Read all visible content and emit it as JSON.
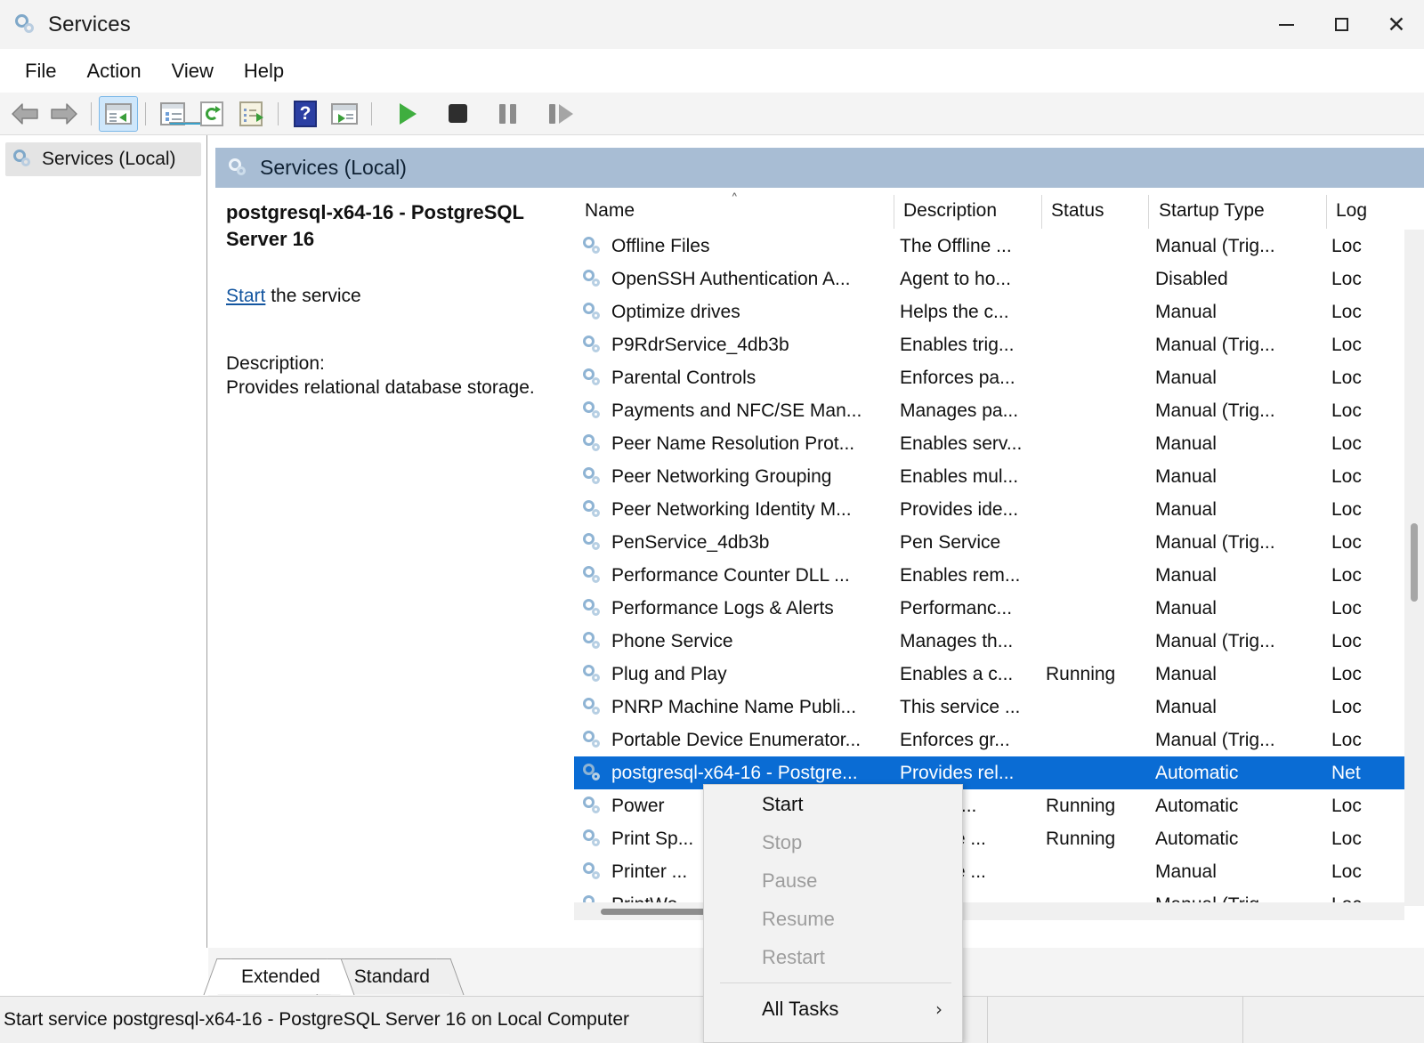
{
  "window": {
    "title": "Services",
    "icon": "services-gear-icon",
    "controls": {
      "minimize": "–",
      "maximize": "□",
      "close": "✕"
    }
  },
  "menubar": {
    "items": [
      "File",
      "Action",
      "View",
      "Help"
    ]
  },
  "toolbar": {
    "buttons": [
      {
        "name": "back-icon",
        "label": "Back"
      },
      {
        "name": "forward-icon",
        "label": "Forward"
      },
      {
        "name": "show-hide-console-tree-icon",
        "label": "Show/Hide Console Tree"
      },
      {
        "name": "properties-icon",
        "label": "Properties"
      },
      {
        "name": "refresh-icon",
        "label": "Refresh"
      },
      {
        "name": "export-list-icon",
        "label": "Export List"
      },
      {
        "name": "help-icon",
        "label": "Help"
      },
      {
        "name": "show-action-pane-icon",
        "label": "Show Action Pane"
      },
      {
        "name": "start-service-icon",
        "label": "Start Service"
      },
      {
        "name": "stop-service-icon",
        "label": "Stop Service"
      },
      {
        "name": "pause-service-icon",
        "label": "Pause Service"
      },
      {
        "name": "restart-service-icon",
        "label": "Restart Service"
      }
    ]
  },
  "sidebar": {
    "items": [
      {
        "label": "Services (Local)",
        "icon": "services-gear-icon"
      }
    ]
  },
  "detail": {
    "header_title": "Services (Local)",
    "service_title": "postgresql-x64-16 - PostgreSQL Server 16",
    "action_link": "Start",
    "action_suffix": " the service",
    "description_label": "Description:",
    "description_text": "Provides relational database storage."
  },
  "list": {
    "columns": [
      {
        "key": "name",
        "label": "Name",
        "sorted": "asc",
        "sort_caret": "˄"
      },
      {
        "key": "description",
        "label": "Description"
      },
      {
        "key": "status",
        "label": "Status"
      },
      {
        "key": "startup",
        "label": "Startup Type"
      },
      {
        "key": "logon",
        "label": "Log"
      }
    ],
    "rows": [
      {
        "name": "Offline Files",
        "description": "The Offline ...",
        "status": "",
        "startup": "Manual (Trig...",
        "logon": "Loc",
        "selected": false
      },
      {
        "name": "OpenSSH Authentication A...",
        "description": "Agent to ho...",
        "status": "",
        "startup": "Disabled",
        "logon": "Loc",
        "selected": false
      },
      {
        "name": "Optimize drives",
        "description": "Helps the c...",
        "status": "",
        "startup": "Manual",
        "logon": "Loc",
        "selected": false
      },
      {
        "name": "P9RdrService_4db3b",
        "description": "Enables trig...",
        "status": "",
        "startup": "Manual (Trig...",
        "logon": "Loc",
        "selected": false
      },
      {
        "name": "Parental Controls",
        "description": "Enforces pa...",
        "status": "",
        "startup": "Manual",
        "logon": "Loc",
        "selected": false
      },
      {
        "name": "Payments and NFC/SE Man...",
        "description": "Manages pa...",
        "status": "",
        "startup": "Manual (Trig...",
        "logon": "Loc",
        "selected": false
      },
      {
        "name": "Peer Name Resolution Prot...",
        "description": "Enables serv...",
        "status": "",
        "startup": "Manual",
        "logon": "Loc",
        "selected": false
      },
      {
        "name": "Peer Networking Grouping",
        "description": "Enables mul...",
        "status": "",
        "startup": "Manual",
        "logon": "Loc",
        "selected": false
      },
      {
        "name": "Peer Networking Identity M...",
        "description": "Provides ide...",
        "status": "",
        "startup": "Manual",
        "logon": "Loc",
        "selected": false
      },
      {
        "name": "PenService_4db3b",
        "description": "Pen Service",
        "status": "",
        "startup": "Manual (Trig...",
        "logon": "Loc",
        "selected": false
      },
      {
        "name": "Performance Counter DLL ...",
        "description": "Enables rem...",
        "status": "",
        "startup": "Manual",
        "logon": "Loc",
        "selected": false
      },
      {
        "name": "Performance Logs & Alerts",
        "description": "Performanc...",
        "status": "",
        "startup": "Manual",
        "logon": "Loc",
        "selected": false
      },
      {
        "name": "Phone Service",
        "description": "Manages th...",
        "status": "",
        "startup": "Manual (Trig...",
        "logon": "Loc",
        "selected": false
      },
      {
        "name": "Plug and Play",
        "description": "Enables a c...",
        "status": "Running",
        "startup": "Manual",
        "logon": "Loc",
        "selected": false
      },
      {
        "name": "PNRP Machine Name Publi...",
        "description": "This service ...",
        "status": "",
        "startup": "Manual",
        "logon": "Loc",
        "selected": false
      },
      {
        "name": "Portable Device Enumerator...",
        "description": "Enforces gr...",
        "status": "",
        "startup": "Manual (Trig...",
        "logon": "Loc",
        "selected": false
      },
      {
        "name": "postgresql-x64-16 - Postgre...",
        "description": "Provides rel...",
        "status": "",
        "startup": "Automatic",
        "logon": "Net",
        "selected": true
      },
      {
        "name": "Power",
        "description": "...ges p...",
        "status": "Running",
        "startup": "Automatic",
        "logon": "Loc",
        "selected": false
      },
      {
        "name": "Print Sp...",
        "description": "...ervice ...",
        "status": "Running",
        "startup": "Automatic",
        "logon": "Loc",
        "selected": false
      },
      {
        "name": "Printer ...",
        "description": "...ervice ...",
        "status": "",
        "startup": "Manual",
        "logon": "Loc",
        "selected": false
      },
      {
        "name": "PrintWo...",
        "description": "...les su...",
        "status": "",
        "startup": "Manual (Trig...",
        "logon": "Loc",
        "selected": false
      }
    ]
  },
  "context_menu": {
    "items": [
      {
        "label": "Start",
        "disabled": false,
        "submenu": false
      },
      {
        "label": "Stop",
        "disabled": true,
        "submenu": false
      },
      {
        "label": "Pause",
        "disabled": true,
        "submenu": false
      },
      {
        "label": "Resume",
        "disabled": true,
        "submenu": false
      },
      {
        "label": "Restart",
        "disabled": true,
        "submenu": false
      },
      {
        "label": "All Tasks",
        "disabled": false,
        "submenu": true,
        "submenu_glyph": "›"
      }
    ]
  },
  "tabs": [
    {
      "label": "Extended",
      "active": true
    },
    {
      "label": "Standard",
      "active": false
    }
  ],
  "statusbar": {
    "text": "Start service postgresql-x64-16 - PostgreSQL Server 16 on Local Computer"
  },
  "colors": {
    "selection_blue": "#0a6cd4",
    "detail_header": "#a8bdd4",
    "link_blue": "#1456a0",
    "toolbar_bg": "#f4f4f4",
    "green_play": "#3fae3f"
  }
}
